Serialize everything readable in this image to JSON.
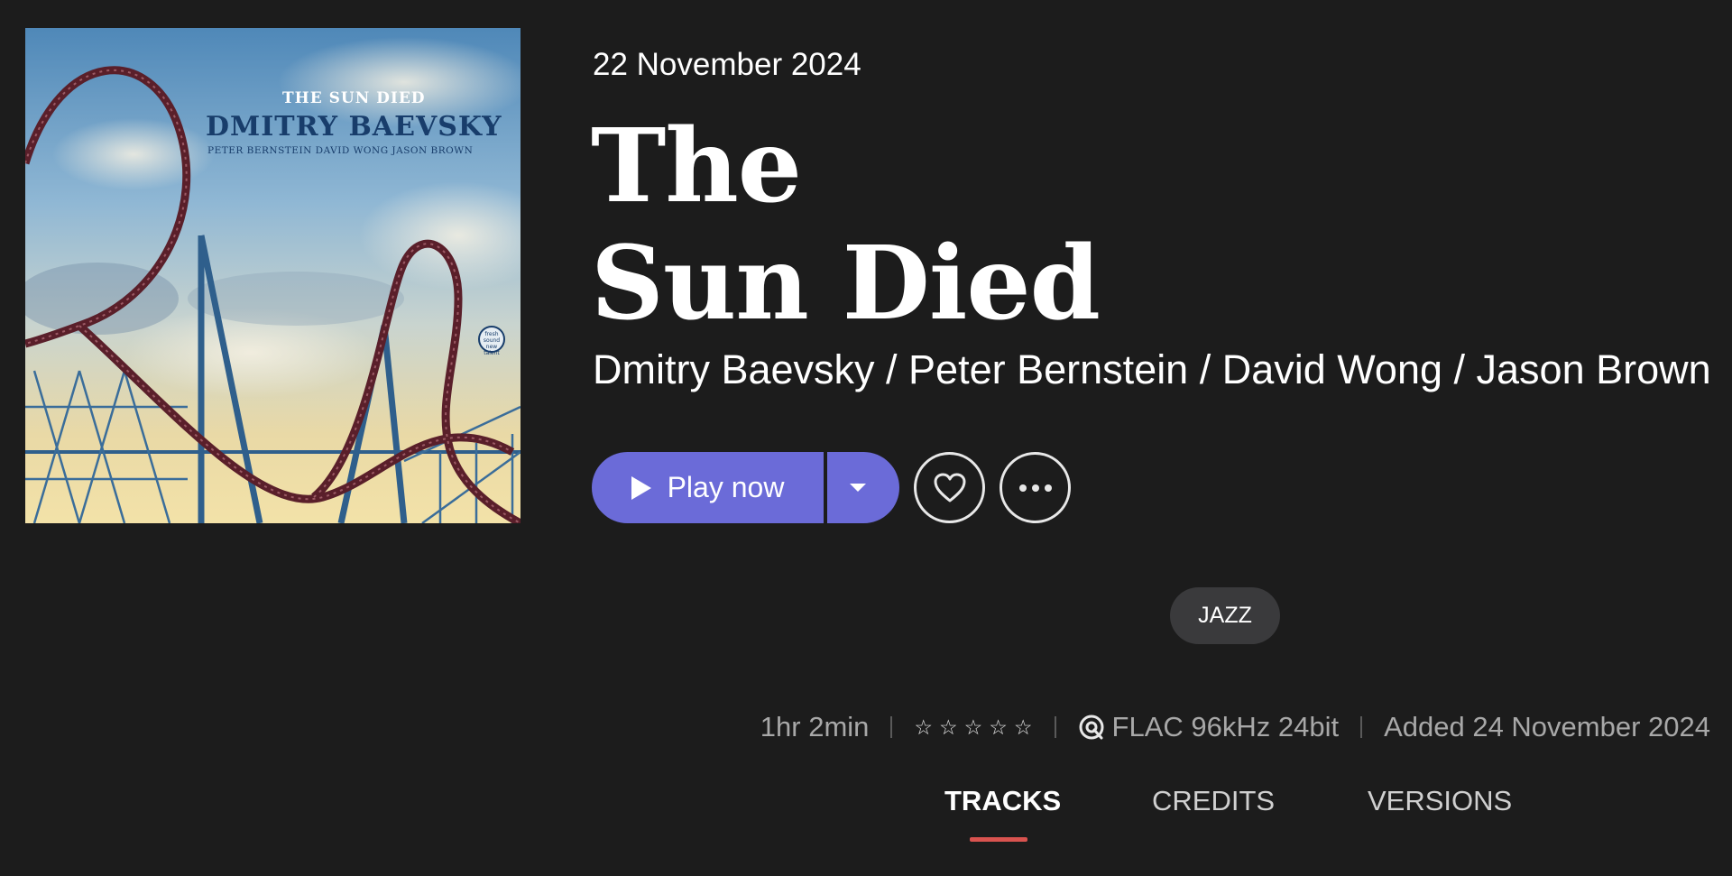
{
  "album": {
    "release_date": "22 November 2024",
    "title_line1": "The",
    "title_line2": "Sun Died",
    "artists": "Dmitry Baevsky / Peter Bernstein / David Wong / Jason Brown"
  },
  "cover": {
    "title": "THE SUN DIED",
    "artist": "DMITRY BAEVSKY",
    "band": "PETER BERNSTEIN   DAVID WONG   JASON BROWN",
    "label_logo": "fresh sound new talent"
  },
  "actions": {
    "play_label": "Play now",
    "dropdown_icon": "chevron-down-icon",
    "favorite_icon": "heart-icon",
    "more_icon": "more-icon"
  },
  "genre": "JAZZ",
  "meta": {
    "duration": "1hr 2min",
    "rating_stars": 0,
    "rating_max": 5,
    "quality": "FLAC 96kHz 24bit",
    "added": "Added 24 November 2024"
  },
  "tabs": [
    {
      "label": "TRACKS",
      "active": true
    },
    {
      "label": "CREDITS",
      "active": false
    },
    {
      "label": "VERSIONS",
      "active": false
    }
  ],
  "colors": {
    "background": "#1c1c1c",
    "accent": "#6b6bd8",
    "tab_indicator": "#d9534f",
    "muted_text": "#a8a8a8"
  }
}
